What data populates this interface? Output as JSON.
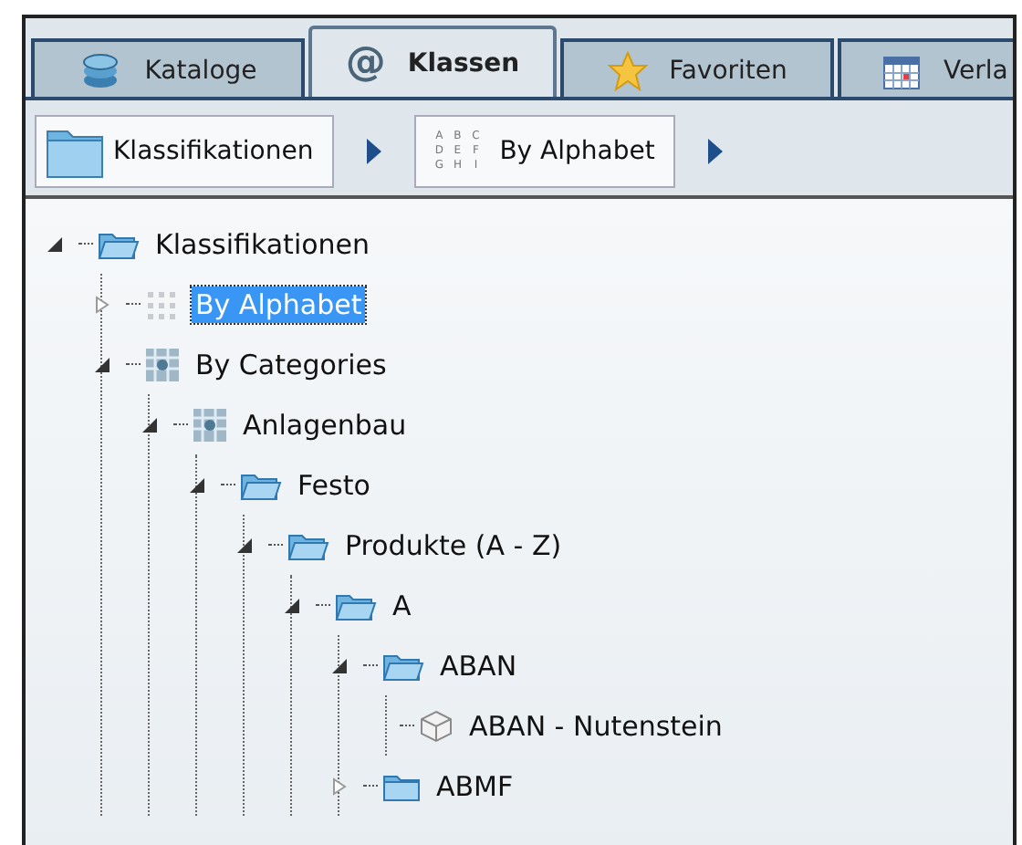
{
  "tabs": [
    {
      "label": "Kataloge",
      "kind": "books",
      "selected": false
    },
    {
      "label": "Klassen",
      "kind": "at",
      "icon_glyph": "@",
      "selected": true
    },
    {
      "label": "Favoriten",
      "kind": "star",
      "selected": false
    },
    {
      "label": "Verla",
      "kind": "calendar",
      "selected": false
    }
  ],
  "breadcrumb": [
    {
      "label": "Klassifikationen",
      "kind": "folder"
    },
    {
      "label": "By Alphabet",
      "kind": "alphabet",
      "icon_letters": [
        "A",
        "B",
        "C",
        "D",
        "E",
        "F",
        "G",
        "H",
        "I"
      ]
    }
  ],
  "tree": [
    {
      "label": "Klassifikationen",
      "kind": "folder-open",
      "expanded": true,
      "selected": false,
      "children": [
        {
          "label": "By Alphabet",
          "kind": "alphabet",
          "expanded": false,
          "selected": true
        },
        {
          "label": "By Categories",
          "kind": "category",
          "expanded": true,
          "selected": false,
          "children": [
            {
              "label": "Anlagenbau",
              "kind": "category",
              "expanded": true,
              "selected": false,
              "children": [
                {
                  "label": "Festo",
                  "kind": "folder-open",
                  "expanded": true,
                  "selected": false,
                  "children": [
                    {
                      "label": "Produkte (A - Z)",
                      "kind": "folder-open",
                      "expanded": true,
                      "selected": false,
                      "children": [
                        {
                          "label": "A",
                          "kind": "folder-open",
                          "expanded": true,
                          "selected": false,
                          "children": [
                            {
                              "label": "ABAN",
                              "kind": "folder-open",
                              "expanded": true,
                              "selected": false,
                              "children": [
                                {
                                  "label": "ABAN - Nutenstein",
                                  "kind": "part",
                                  "selected": false
                                }
                              ]
                            },
                            {
                              "label": "ABMF",
                              "kind": "folder",
                              "expanded": false,
                              "selected": false
                            }
                          ]
                        }
                      ]
                    }
                  ]
                }
              ]
            }
          ]
        }
      ]
    }
  ]
}
